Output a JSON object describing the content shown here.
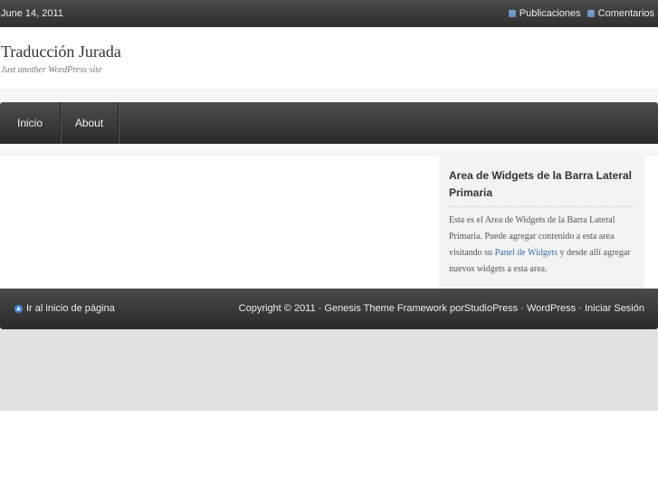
{
  "topbar": {
    "date": "June 14, 2011",
    "feeds": [
      {
        "label": "Publicaciones",
        "icon": "rss-icon"
      },
      {
        "label": "Comentarios",
        "icon": "rss-icon"
      }
    ]
  },
  "header": {
    "title": "Traducción Jurada",
    "description": "Just another WordPress site"
  },
  "nav": {
    "items": [
      {
        "label": "Inicio"
      },
      {
        "label": "About"
      }
    ]
  },
  "sidebar": {
    "widget_title": "Area de Widgets de la Barra Lateral Primaria",
    "text_before": "Esta es el Area de Widgets de la Barra Lateral Primaria. Puede agregar contenido a esta area visitando su ",
    "link_label": "Panel de Widgets",
    "text_after": " y desde allí agregar nuevos widgets a esta area."
  },
  "footer": {
    "back_to_top": "Ir al inicio de página",
    "copyright": "Copyright © 2011 · ",
    "theme_link": "Genesis Theme Framework",
    "by": " por",
    "studiopress_link": "StudioPress",
    "sep1": " · ",
    "wordpress_link": "WordPress",
    "sep2": " · ",
    "login_link": "Iniciar Sesión"
  },
  "colors": {
    "dark_bar": "#3a3a3a",
    "link": "#3a6ea5",
    "sidebar_bg": "#f3f3f3",
    "bottom_band": "#e2e2e2"
  }
}
